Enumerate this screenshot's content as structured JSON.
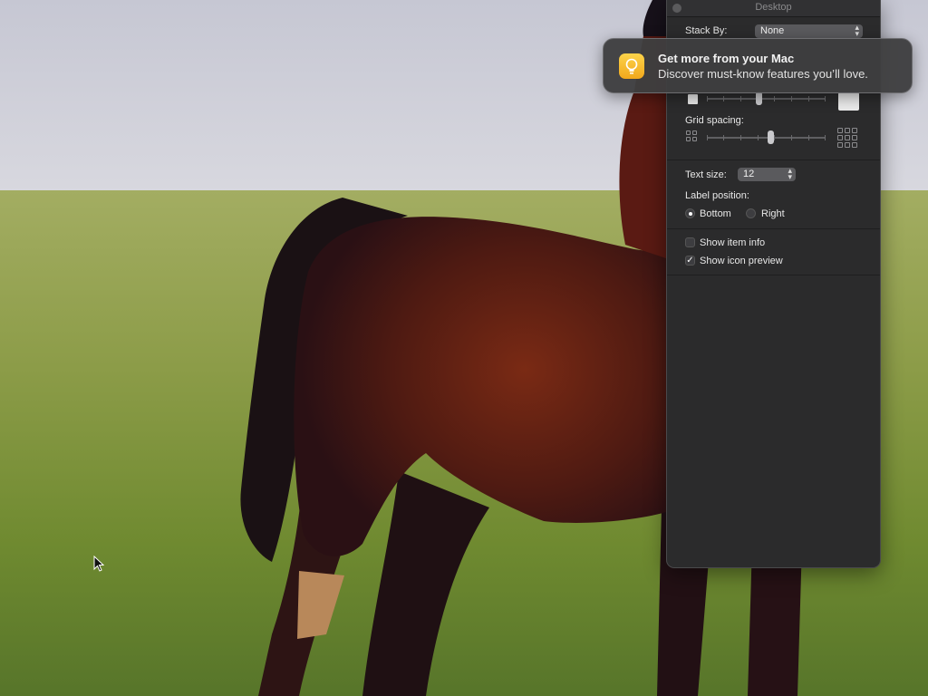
{
  "window": {
    "title": "Desktop"
  },
  "stack_by": {
    "label": "Stack By:",
    "value": "None"
  },
  "icon_size": {
    "value_fraction": 0.5
  },
  "grid_spacing": {
    "label": "Grid spacing:",
    "value_fraction": 0.53
  },
  "text_size": {
    "label": "Text size:",
    "value": "12"
  },
  "label_position": {
    "label": "Label position:",
    "options": [
      {
        "label": "Bottom",
        "selected": true
      },
      {
        "label": "Right",
        "selected": false
      }
    ]
  },
  "show_item_info": {
    "label": "Show item info",
    "checked": false
  },
  "show_icon_preview": {
    "label": "Show icon preview",
    "checked": true
  },
  "notification": {
    "icon": "lightbulb-icon",
    "title": "Get more from your Mac",
    "body": "Discover must-know features you’ll love."
  },
  "colors": {
    "panel_bg": "#2b2b2c",
    "notification_icon": "#f7c030"
  }
}
